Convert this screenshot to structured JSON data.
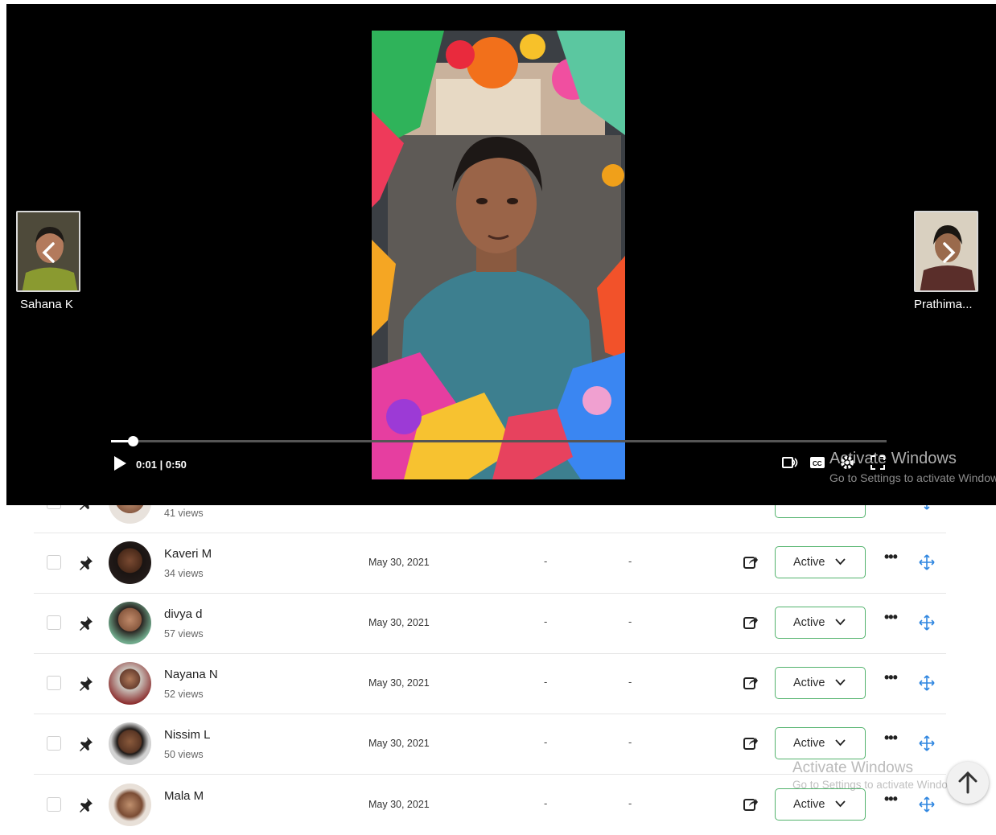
{
  "list": {
    "rows": [
      {
        "name": "",
        "views": "41 views",
        "date": "",
        "col3": "",
        "col4": "",
        "status": ""
      },
      {
        "name": "Kaveri M",
        "views": "34 views",
        "date": "May 30, 2021",
        "col3": "-",
        "col4": "-",
        "status": "Active"
      },
      {
        "name": "divya d",
        "views": "57 views",
        "date": "May 30, 2021",
        "col3": "-",
        "col4": "-",
        "status": "Active"
      },
      {
        "name": "Nayana N",
        "views": "52 views",
        "date": "May 30, 2021",
        "col3": "-",
        "col4": "-",
        "status": "Active"
      },
      {
        "name": "Nissim L",
        "views": "50 views",
        "date": "May 30, 2021",
        "col3": "-",
        "col4": "-",
        "status": "Active"
      },
      {
        "name": "Mala M",
        "views": "",
        "date": "May 30, 2021",
        "col3": "-",
        "col4": "-",
        "status": "Active"
      }
    ],
    "more_label": "•••"
  },
  "player": {
    "prev_name": "Sahana K",
    "next_name": "Prathima...",
    "time": "0:01 | 0:50",
    "progress_fraction": 0.02,
    "icons": [
      "chevron-left-icon",
      "chevron-right-icon",
      "play-icon",
      "audio-icon",
      "cc-icon",
      "settings-icon",
      "fullscreen-icon"
    ]
  },
  "watermark": {
    "title": "Activate Windows",
    "subtitle": "Go to Settings to activate Windows."
  },
  "colors": {
    "status_border": "#53b36d",
    "drag_icon": "#2f86e0",
    "overlay_bg": "#000000"
  }
}
